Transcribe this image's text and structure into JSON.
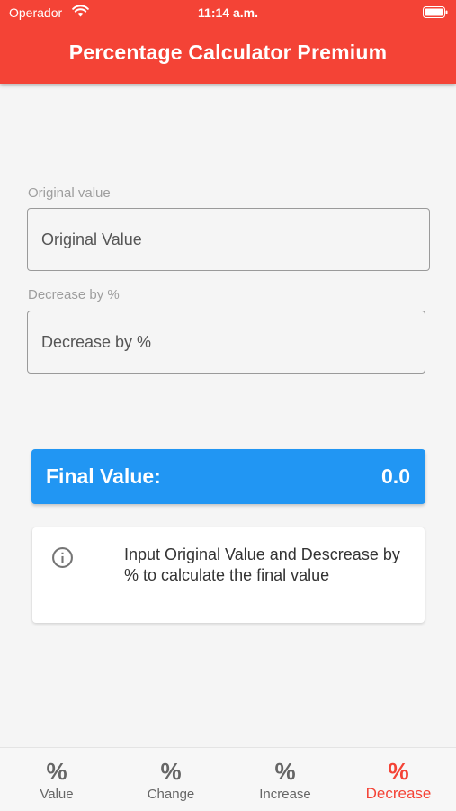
{
  "colors": {
    "accent": "#f44336",
    "result": "#2196f3"
  },
  "status_bar": {
    "carrier": "Operador",
    "time": "11:14 a.m.",
    "wifi_icon": "wifi-icon",
    "battery_icon": "battery-icon"
  },
  "header": {
    "title": "Percentage Calculator Premium"
  },
  "form": {
    "original": {
      "label": "Original value",
      "placeholder": "Original Value"
    },
    "decrease": {
      "label": "Decrease by %",
      "placeholder": "Decrease by %"
    }
  },
  "result": {
    "label": "Final Value:",
    "value": "0.0"
  },
  "info": {
    "icon": "info-icon",
    "text": "Input Original Value and Descrease by % to calculate the final value"
  },
  "bottom_nav": {
    "items": [
      {
        "label": "Value",
        "icon": "percent-icon"
      },
      {
        "label": "Change",
        "icon": "percent-icon"
      },
      {
        "label": "Increase",
        "icon": "percent-icon"
      },
      {
        "label": "Decrease",
        "icon": "percent-icon",
        "active": true
      }
    ]
  }
}
